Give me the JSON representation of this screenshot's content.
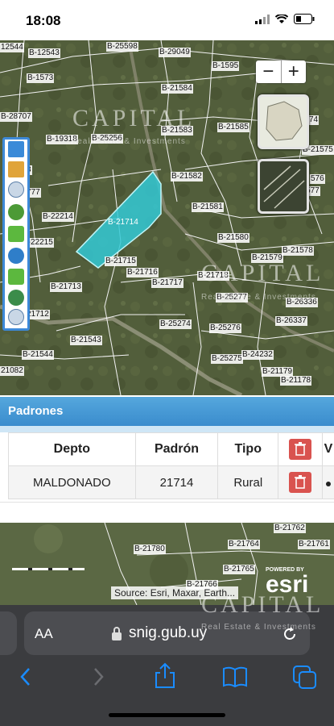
{
  "status_bar": {
    "time": "18:08"
  },
  "map": {
    "watermark": {
      "brand": "CAPITAL",
      "tagline": "Real Estate & Investments"
    },
    "parcel_labels": [
      "12544",
      "B-12543",
      "B-25598",
      "B-29049",
      "B-1595",
      "B-1573",
      "B-21584",
      "B-28707",
      "B-19318",
      "B-25256",
      "B-21583",
      "B-21585",
      "B-21575",
      "74",
      "B-21582",
      "576",
      "B-22214",
      "B-21714",
      "B-21581",
      "B-21577",
      "B-22215",
      "B-21580",
      "B-21578",
      "B-21715",
      "B-21716",
      "B-21579",
      "B-21713",
      "B-21717",
      "B-21718",
      "B-25277",
      "B-26336",
      "21712",
      "B-21543",
      "B-25274",
      "B-25276",
      "B-26337",
      "B-21544",
      "B-25275",
      "B-24232",
      "21082",
      "B-21179",
      "B-21178",
      "777",
      "8"
    ],
    "zoom_out_label": "−",
    "zoom_in_label": "+"
  },
  "panel": {
    "title": "Padrones",
    "columns": [
      "Depto",
      "Padrón",
      "Tipo",
      "",
      "V"
    ],
    "rows": [
      {
        "depto": "MALDONADO",
        "padron": "21714",
        "tipo": "Rural"
      }
    ]
  },
  "map_lower": {
    "labels": [
      "B-21762",
      "B-21780",
      "B-21764",
      "B-21761",
      "B-21765",
      "B-21766"
    ],
    "attribution": "Source: Esri, Maxar, Earth...",
    "powered_by": "POWERED BY",
    "esri": "esri"
  },
  "browser": {
    "aa_label": "AA",
    "url": "snig.gub.uy"
  },
  "colors": {
    "panel_header": "#3a8ccd",
    "delete_button": "#d9534f",
    "selected_parcel": "#33c9d6",
    "browser_bg": "#3b3c3f",
    "ios_blue": "#1a8cff"
  },
  "icons": {
    "lock": "lock-icon",
    "reload": "reload-icon",
    "back": "back-icon",
    "forward": "forward-icon",
    "share": "share-icon",
    "bookmarks": "bookmarks-icon",
    "tabs": "tabs-icon",
    "trash": "trash-icon"
  }
}
